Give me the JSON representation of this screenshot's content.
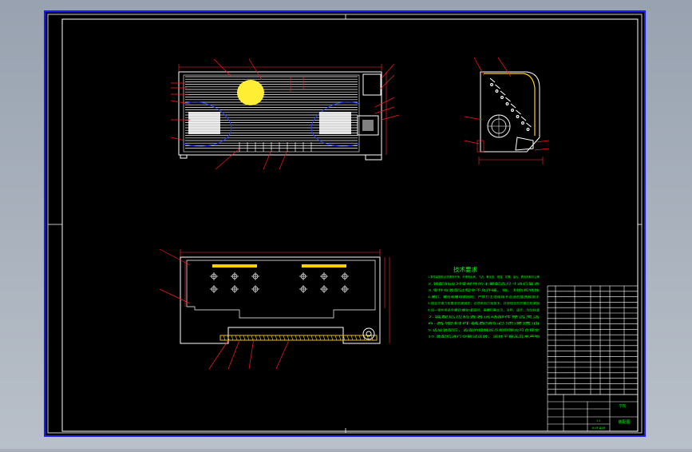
{
  "colors": {
    "background": "#000000",
    "viewport": "#a9b0bb",
    "frame": "#1a1aff",
    "outline": "#ffffff",
    "leader": "#ff1a1a",
    "dimension": "#ff3030",
    "note_text": "#00ff00",
    "highlight": "#ffee33",
    "hatch": "#ffd000",
    "curve": "#2244ff"
  },
  "tech_requirements": {
    "title": "技术要求",
    "lines": [
      "1.零件装配前必须清洗干净，不得有毛刺、飞边、氧化皮、锈蚀、切屑、油污、着色剂和灰尘等",
      "2.装配前应对零部件的主要配合尺寸进行复查",
      "3.零件在装配过程中不允许磕、碰、划伤和锈蚀",
      "4.螺钉、螺栓和螺母紧固时，严禁打击或使用不合适的旋具和扳手",
      "5.规定拧紧力矩要求的紧固件，必须采用力矩扳手，并按规定的拧紧力矩紧固",
      "6.同一零件用多件螺钉(螺栓)紧固时，各螺钉需交叉、对称、逐步、均匀拧紧",
      "7.装配后应检查各运动部件是否灵活",
      "8.各密封件装配前必须浸透油",
      "9.齿轮装配后，齿面的接触斑点和侧隙应符合规定",
      "10.装配后进行空载试运转，运转平稳无异常声响"
    ]
  },
  "title_block": {
    "school": "学院",
    "drawing_name": "装配图",
    "scale": "1:1",
    "sheet": "共1张 第1张"
  }
}
